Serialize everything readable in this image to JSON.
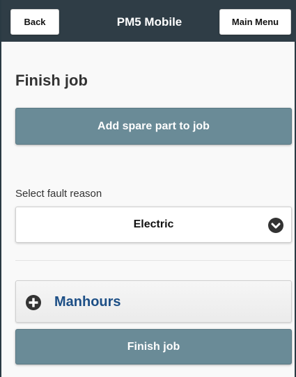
{
  "header": {
    "title": "PM5 Mobile",
    "back_label": "Back",
    "main_menu_label": "Main Menu"
  },
  "page": {
    "heading": "Finish job"
  },
  "actions": {
    "add_spare_label": "Add spare part to job",
    "finish_label": "Finish job"
  },
  "fault_reason": {
    "label": "Select fault reason",
    "selected": "Electric"
  },
  "collapsible": {
    "label": "Manhours",
    "icon": "plus-circle-icon"
  },
  "colors": {
    "header_bg": "#2f3d46",
    "button_bg": "#6a8b97",
    "link_text": "#1d4f86"
  }
}
